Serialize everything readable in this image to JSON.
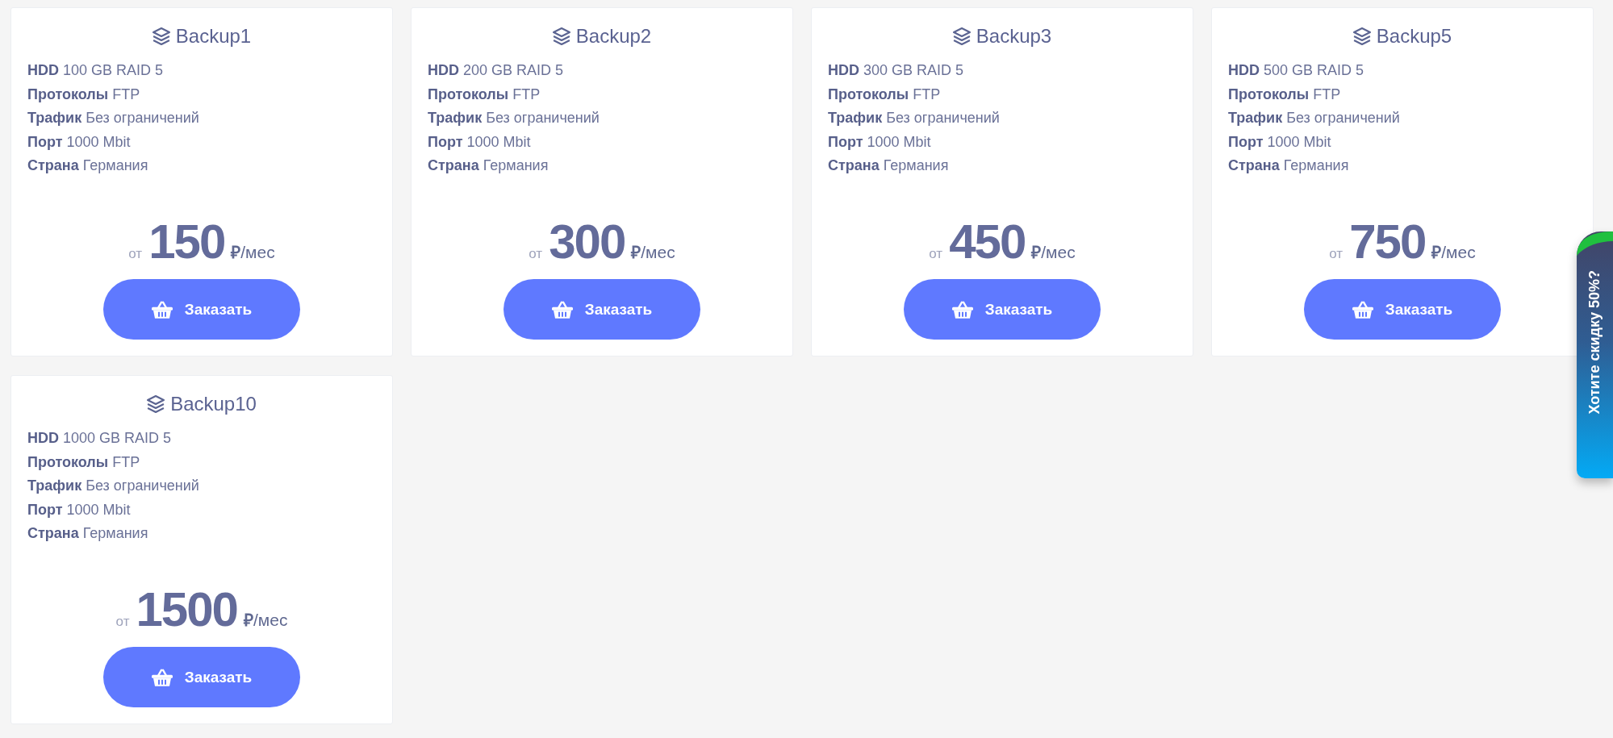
{
  "plans": [
    {
      "name": "Backup1",
      "specs": [
        {
          "label": "HDD",
          "value": "100 GB RAID 5"
        },
        {
          "label": "Протоколы",
          "value": "FTP"
        },
        {
          "label": "Трафик",
          "value": "Без ограничений"
        },
        {
          "label": "Порт",
          "value": "1000 Mbit"
        },
        {
          "label": "Страна",
          "value": "Германия"
        }
      ],
      "price_prefix": "от",
      "price": "150",
      "price_unit": "**₽**/мес",
      "order_button": "Заказать"
    },
    {
      "name": "Backup2",
      "specs": [
        {
          "label": "HDD",
          "value": "200 GB RAID 5"
        },
        {
          "label": "Протоколы",
          "value": "FTP"
        },
        {
          "label": "Трафик",
          "value": "Без ограничений"
        },
        {
          "label": "Порт",
          "value": "1000 Mbit"
        },
        {
          "label": "Страна",
          "value": "Германия"
        }
      ],
      "price_prefix": "от",
      "price": "300",
      "price_unit": "**₽**/мес",
      "order_button": "Заказать"
    },
    {
      "name": "Backup3",
      "specs": [
        {
          "label": "HDD",
          "value": "300 GB RAID 5"
        },
        {
          "label": "Протоколы",
          "value": "FTP"
        },
        {
          "label": "Трафик",
          "value": "Без ограничений"
        },
        {
          "label": "Порт",
          "value": "1000 Mbit"
        },
        {
          "label": "Страна",
          "value": "Германия"
        }
      ],
      "price_prefix": "от",
      "price": "450",
      "price_unit": "**₽**/мес",
      "order_button": "Заказать"
    },
    {
      "name": "Backup5",
      "specs": [
        {
          "label": "HDD",
          "value": "500 GB RAID 5"
        },
        {
          "label": "Протоколы",
          "value": "FTP"
        },
        {
          "label": "Трафик",
          "value": "Без ограничений"
        },
        {
          "label": "Порт",
          "value": "1000 Mbit"
        },
        {
          "label": "Страна",
          "value": "Германия"
        }
      ],
      "price_prefix": "от",
      "price": "750",
      "price_unit": "**₽**/мес",
      "order_button": "Заказать"
    },
    {
      "name": "Backup10",
      "specs": [
        {
          "label": "HDD",
          "value": "1000 GB RAID 5"
        },
        {
          "label": "Протоколы",
          "value": "FTP"
        },
        {
          "label": "Трафик",
          "value": "Без ограничений"
        },
        {
          "label": "Порт",
          "value": "1000 Mbit"
        },
        {
          "label": "Страна",
          "value": "Германия"
        }
      ],
      "price_prefix": "от",
      "price": "1500",
      "price_unit": "**₽**/мес",
      "order_button": "Заказать"
    }
  ],
  "discount_tab": {
    "label": "Хотите скидку 50%?"
  }
}
